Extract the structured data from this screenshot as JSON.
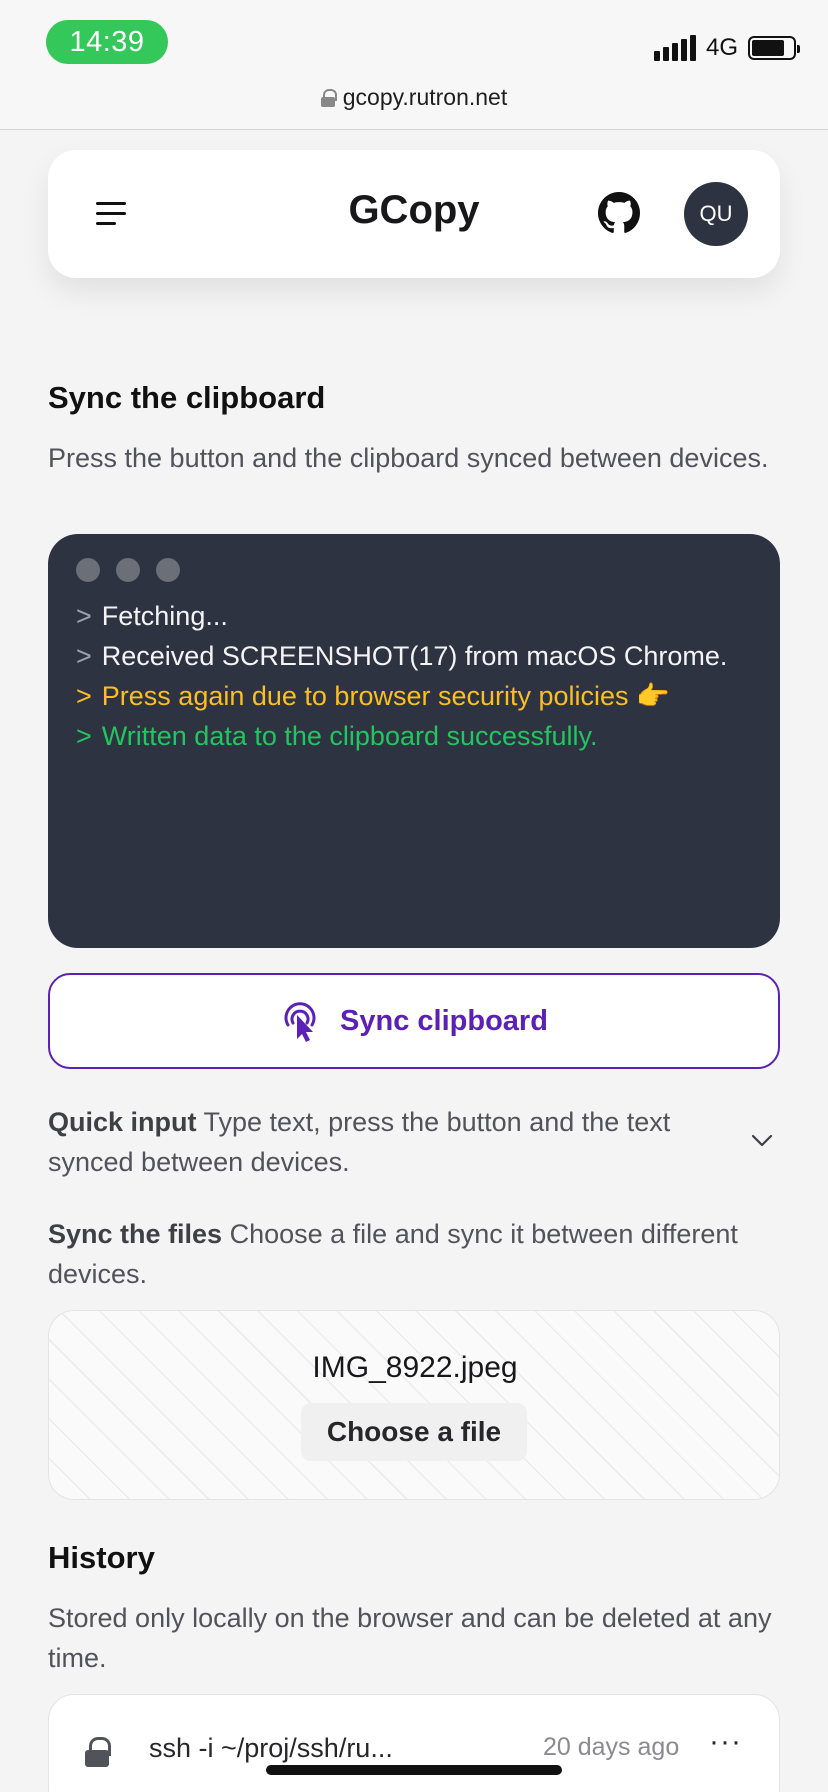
{
  "status_bar": {
    "time": "14:39",
    "network": "4G",
    "url": "gcopy.rutron.net",
    "icons": [
      "lock-icon",
      "signal-icon",
      "battery-icon"
    ]
  },
  "header": {
    "title": "GCopy",
    "avatar_initials": "QU",
    "icons": [
      "menu-icon",
      "github-icon"
    ]
  },
  "sync_clipboard": {
    "title": "Sync the clipboard",
    "description": "Press the button and the clipboard synced between devices.",
    "terminal": {
      "prompt": ">",
      "lines": [
        "Fetching...",
        "Received SCREENSHOT(17) from macOS Chrome.",
        "Press again due to browser security policies 👉",
        "Written data to the clipboard successfully."
      ],
      "colors": {
        "background": "#2d3341",
        "warning": "#fbbf24",
        "success": "#22c55e"
      }
    },
    "button_label": "Sync clipboard",
    "button_icon": "tap-pointer-icon",
    "accent_color": "#5b21b6"
  },
  "quick_input": {
    "label": "Quick input",
    "description": "Type text, press the button and the text synced between devices."
  },
  "sync_files": {
    "label": "Sync the files",
    "description": "Choose a file and sync it between different devices.",
    "file_name": "IMG_8922.jpeg",
    "choose_label": "Choose a file"
  },
  "history": {
    "title": "History",
    "description": "Stored only locally on the browser and can be deleted at any time.",
    "items": [
      {
        "text": "ssh -i ~/proj/ssh/ru...",
        "time": "20 days ago",
        "more": "···"
      }
    ]
  }
}
